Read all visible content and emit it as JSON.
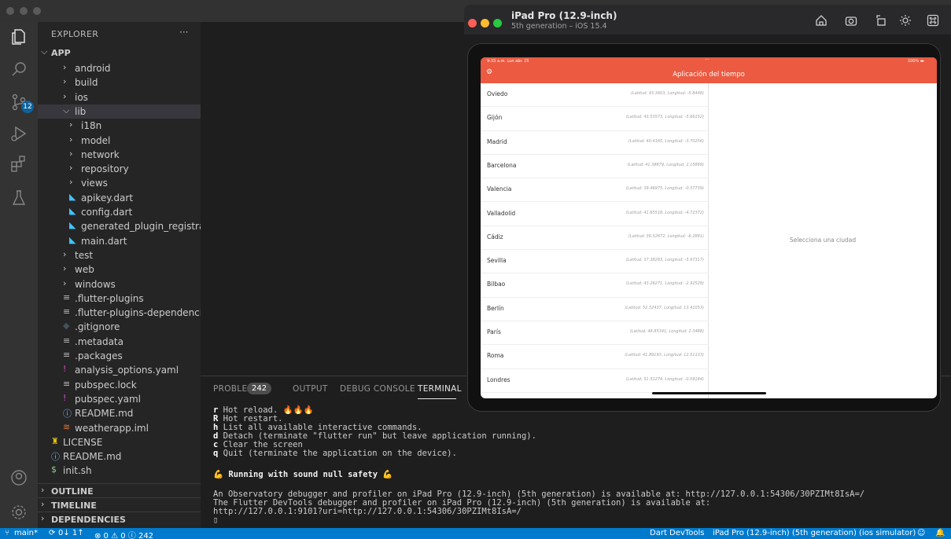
{
  "explorer": {
    "title": "EXPLORER",
    "more": "···",
    "root": "APP",
    "items": [
      {
        "type": "folder-closed",
        "label": "android",
        "indent": 1
      },
      {
        "type": "folder-closed",
        "label": "build",
        "indent": 1
      },
      {
        "type": "folder-closed",
        "label": "ios",
        "indent": 1
      },
      {
        "type": "folder-open",
        "label": "lib",
        "indent": 1,
        "selected": true
      },
      {
        "type": "folder-closed",
        "label": "i18n",
        "indent": 2
      },
      {
        "type": "folder-closed",
        "label": "model",
        "indent": 2
      },
      {
        "type": "folder-closed",
        "label": "network",
        "indent": 2
      },
      {
        "type": "folder-closed",
        "label": "repository",
        "indent": 2
      },
      {
        "type": "folder-closed",
        "label": "views",
        "indent": 2
      },
      {
        "type": "dart",
        "label": "apikey.dart",
        "indent": 2
      },
      {
        "type": "dart",
        "label": "config.dart",
        "indent": 2
      },
      {
        "type": "dart",
        "label": "generated_plugin_registran...",
        "indent": 2
      },
      {
        "type": "dart",
        "label": "main.dart",
        "indent": 2
      },
      {
        "type": "folder-closed",
        "label": "test",
        "indent": 1
      },
      {
        "type": "folder-closed",
        "label": "web",
        "indent": 1
      },
      {
        "type": "folder-closed",
        "label": "windows",
        "indent": 1
      },
      {
        "type": "lines",
        "label": ".flutter-plugins",
        "indent": 1
      },
      {
        "type": "lines",
        "label": ".flutter-plugins-dependencies",
        "indent": 1
      },
      {
        "type": "git",
        "label": ".gitignore",
        "indent": 1
      },
      {
        "type": "lines",
        "label": ".metadata",
        "indent": 1
      },
      {
        "type": "lines",
        "label": ".packages",
        "indent": 1
      },
      {
        "type": "yaml",
        "label": "analysis_options.yaml",
        "indent": 1
      },
      {
        "type": "lines",
        "label": "pubspec.lock",
        "indent": 1
      },
      {
        "type": "yaml",
        "label": "pubspec.yaml",
        "indent": 1
      },
      {
        "type": "info",
        "label": "README.md",
        "indent": 1
      },
      {
        "type": "iml",
        "label": "weatherapp.iml",
        "indent": 1
      },
      {
        "type": "license",
        "label": "LICENSE",
        "indent": 0
      },
      {
        "type": "info",
        "label": "README.md",
        "indent": 0
      },
      {
        "type": "shell",
        "label": "init.sh",
        "indent": 0
      }
    ],
    "sections": [
      "OUTLINE",
      "TIMELINE",
      "DEPENDENCIES"
    ]
  },
  "activity": {
    "icons": [
      "files-icon",
      "search-icon",
      "source-control-icon",
      "run-debug-icon",
      "extensions-icon",
      "testing-icon"
    ],
    "source_control_badge": "12",
    "bottom_icons": [
      "account-icon",
      "settings-gear-icon"
    ]
  },
  "panel": {
    "tabs": [
      "PROBLEMS",
      "OUTPUT",
      "DEBUG CONSOLE",
      "TERMINAL"
    ],
    "problems_count": "242",
    "active_tab": "TERMINAL",
    "terminal_lines": [
      {
        "key": "r",
        "text": " Hot reload. 🔥🔥🔥"
      },
      {
        "key": "R",
        "text": " Hot restart."
      },
      {
        "key": "h",
        "text": " List all available interactive commands."
      },
      {
        "key": "d",
        "text": " Detach (terminate \"flutter run\" but leave application running)."
      },
      {
        "key": "c",
        "text": " Clear the screen"
      },
      {
        "key": "q",
        "text": " Quit (terminate the application on the device)."
      }
    ],
    "sound_null_safety": "💪 Running with sound null safety 💪",
    "observatory": "An Observatory debugger and profiler on iPad Pro (12.9-inch) (5th generation) is available at: http://127.0.0.1:54306/30PZIMt8IsA=/",
    "devtools_1": "The Flutter DevTools debugger and profiler on iPad Pro (12.9-inch) (5th generation) is available at:",
    "devtools_2": "http://127.0.0.1:9101?uri=http://127.0.0.1:54306/30PZIMt8IsA=/",
    "cursor": "▯"
  },
  "simulator": {
    "title": "iPad Pro (12.9-inch)",
    "subtitle": "5th generation – iOS 15.4",
    "status_time": "9:33 a.m.  Lun abr. 25",
    "status_dots": "···",
    "status_battery": "100% ▬",
    "app_title": "Aplicación del tiempo",
    "empty_detail": "Selecciona una ciudad",
    "cities": [
      {
        "name": "Oviedo",
        "coords": "(Latitud: 43.3603, Longitud: -5.8448)"
      },
      {
        "name": "Gijón",
        "coords": "(Latitud: 43.53573, Longitud: -5.66152)"
      },
      {
        "name": "Madrid",
        "coords": "(Latitud: 40.4165, Longitud: -3.70256)"
      },
      {
        "name": "Barcelona",
        "coords": "(Latitud: 41.38879, Longitud: 2.15899)"
      },
      {
        "name": "Valencia",
        "coords": "(Latitud: 39.46975, Longitud: -0.37739)"
      },
      {
        "name": "Valladolid",
        "coords": "(Latitud: 41.65518, Longitud: -4.72372)"
      },
      {
        "name": "Cádiz",
        "coords": "(Latitud: 36.52672, Longitud: -6.2891)"
      },
      {
        "name": "Sevilla",
        "coords": "(Latitud: 37.38283, Longitud: -5.97317)"
      },
      {
        "name": "Bilbao",
        "coords": "(Latitud: 43.26271, Longitud: -2.92528)"
      },
      {
        "name": "Berlín",
        "coords": "(Latitud: 52.52437, Longitud: 13.41053)"
      },
      {
        "name": "París",
        "coords": "(Latitud: 48.85341, Longitud: 2.3488)"
      },
      {
        "name": "Roma",
        "coords": "(Latitud: 41.89193, Longitud: 12.51133)"
      },
      {
        "name": "Londres",
        "coords": "(Latitud: 51.51279, Longitud: -0.09184)"
      }
    ]
  },
  "statusbar": {
    "branch": "main*",
    "sync": "0↓ 1↑",
    "problems": "⊗ 0 ⚠ 0 ⓘ 242",
    "devtools": "Dart DevTools",
    "device": "iPad Pro (12.9-inch) (5th generation) (ios simulator)"
  },
  "colors": {
    "accent": "#007acc",
    "appbar": "#eb5a41",
    "dart": "#40c4ff",
    "yaml": "#cb4bc0",
    "license": "#e5c300",
    "shell": "#89d185",
    "info": "#75beff"
  }
}
